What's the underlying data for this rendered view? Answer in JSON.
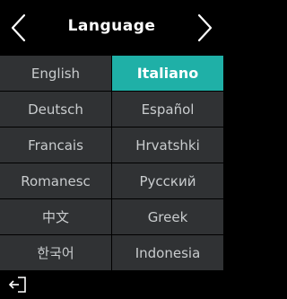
{
  "header": {
    "title": "Language",
    "left_icon": "chevron-left-icon",
    "right_icon": "chevron-right-icon"
  },
  "colors": {
    "accent": "#1fb0a7",
    "cell_bg": "#303234",
    "background": "#000000"
  },
  "languages": [
    [
      "English",
      "Italiano"
    ],
    [
      "Deutsch",
      "Español"
    ],
    [
      "Francais",
      "Hrvatshki"
    ],
    [
      "Romanesc",
      "Русский"
    ],
    [
      "中文",
      "Greek"
    ],
    [
      "한국어",
      "Indonesia"
    ]
  ],
  "selected": "Italiano",
  "footer": {
    "exit_icon": "exit-icon"
  }
}
